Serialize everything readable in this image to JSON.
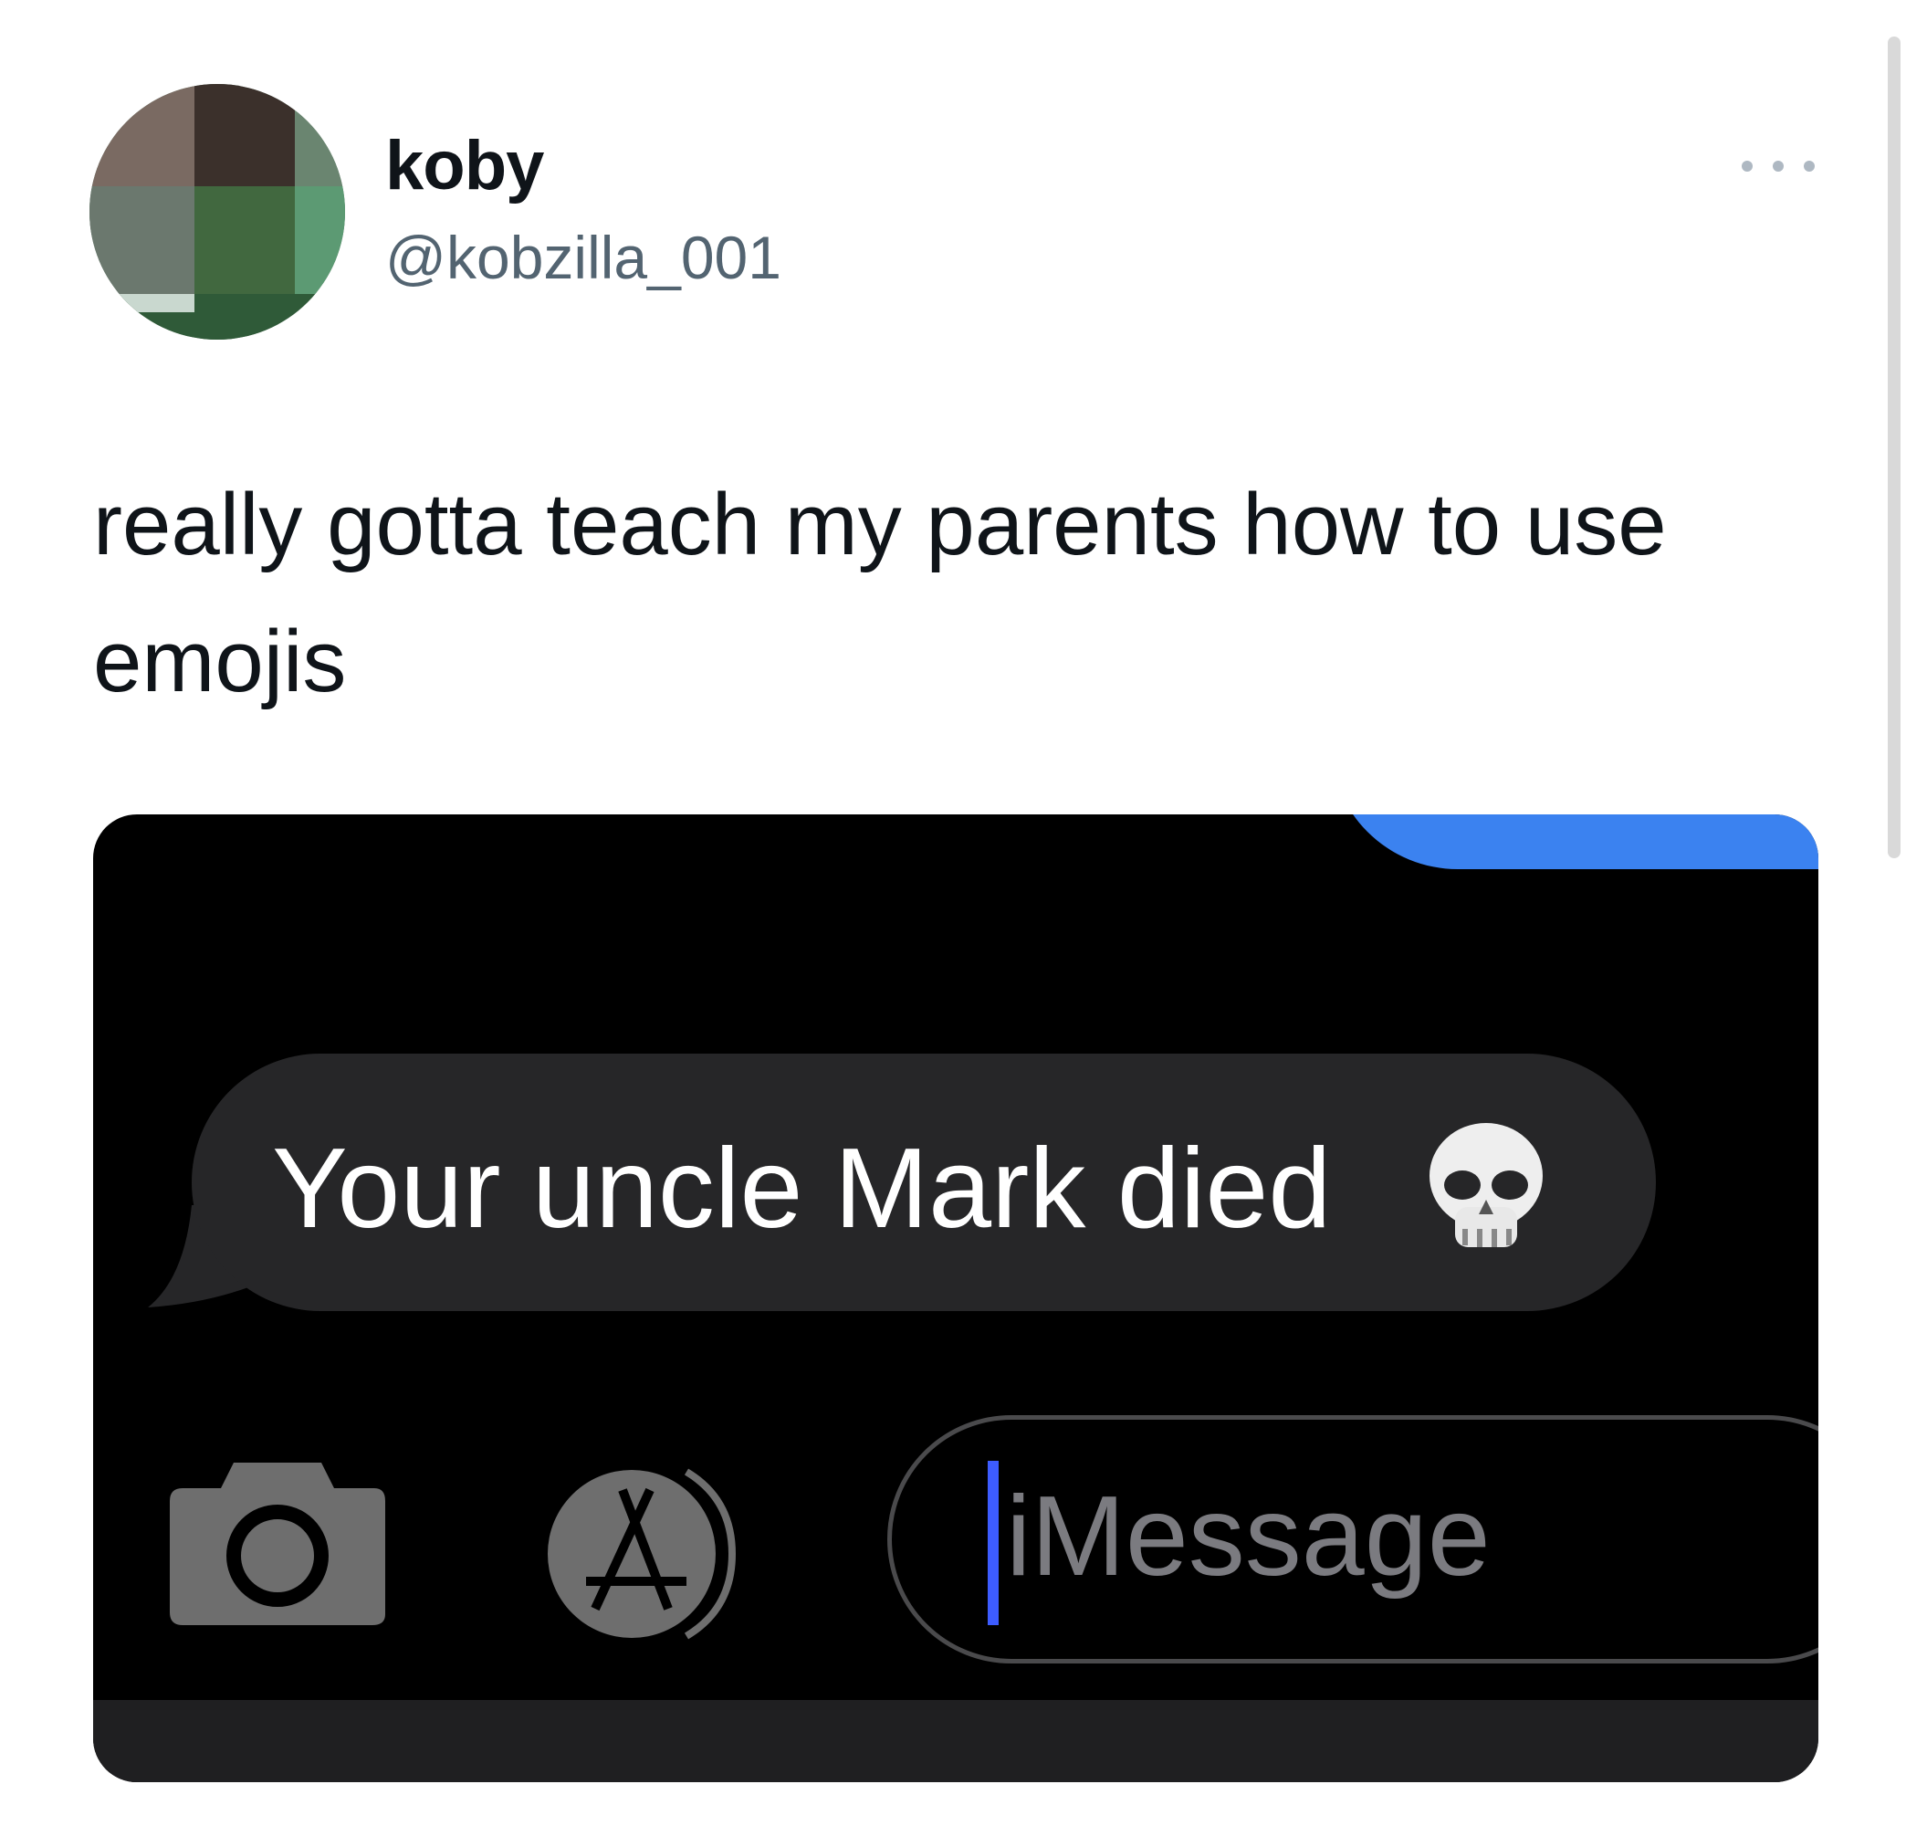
{
  "author": {
    "display_name": "koby",
    "handle": "@kobzilla_001"
  },
  "tweet": {
    "text": "really gotta teach my parents how to use emojis"
  },
  "icons": {
    "more": "more-options-icon",
    "camera": "camera-icon",
    "app_store": "app-store-icon",
    "emoji": "skull-emoji-icon"
  },
  "embedded_screenshot": {
    "received_message": "Your uncle Mark died",
    "input_placeholder": "iMessage"
  },
  "colors": {
    "text_primary": "#0f1419",
    "text_secondary": "#536471",
    "imessage_blue": "#3b82f0",
    "bubble_gray": "#262628",
    "caret_blue": "#3d5cff"
  }
}
